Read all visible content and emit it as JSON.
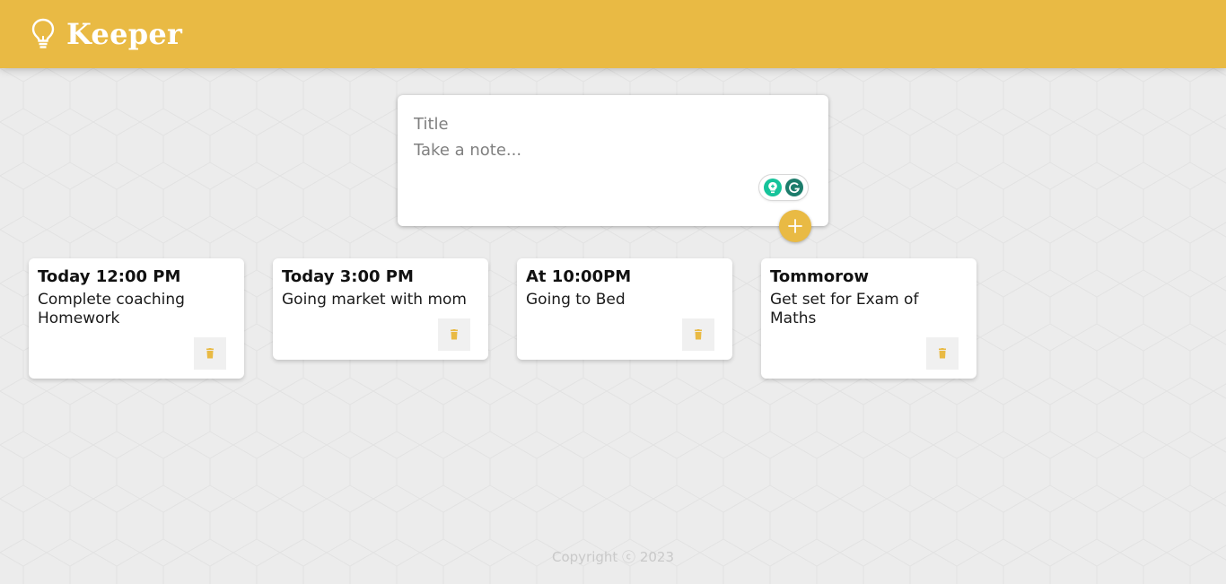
{
  "header": {
    "app_title": "Keeper",
    "logo_icon": "lightbulb-icon"
  },
  "composer": {
    "title_placeholder": "Title",
    "content_placeholder": "Take a note...",
    "add_icon": "plus-icon",
    "grammarly_icons": [
      "lightbulb-badge-icon",
      "grammarly-icon"
    ]
  },
  "notes": [
    {
      "title": "Today 12:00 PM",
      "content": "Complete coaching\nHomework"
    },
    {
      "title": "Today 3:00 PM",
      "content": "Going market with mom"
    },
    {
      "title": "At 10:00PM",
      "content": "Going to Bed"
    },
    {
      "title": "Tommorow",
      "content": "Get set for Exam of\nMaths"
    }
  ],
  "footer": {
    "copyright": "Copyright ⓒ 2023"
  },
  "colors": {
    "accent": "#e9ba44",
    "background": "#ececec",
    "card": "#ffffff",
    "grammarly_green": "#15c39a",
    "grammarly_dark": "#1c7c6b"
  }
}
